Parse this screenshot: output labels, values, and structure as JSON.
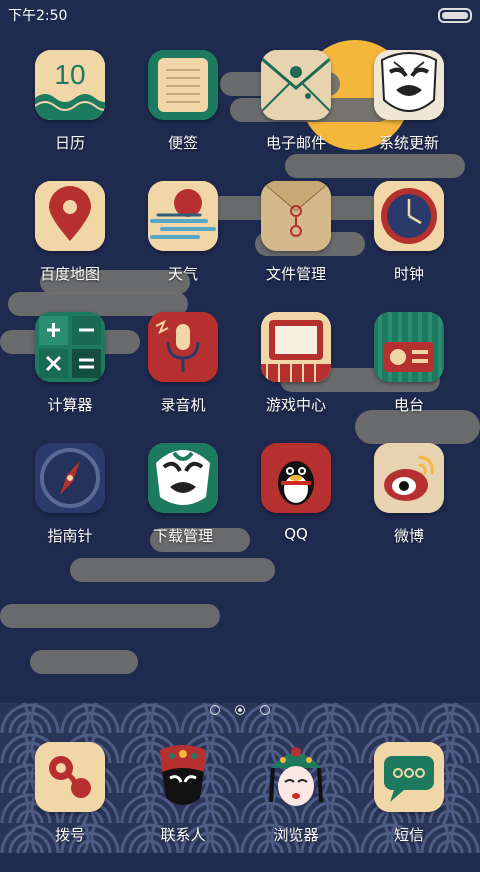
{
  "status": {
    "time": "下午2:50"
  },
  "apps": [
    {
      "label": "日历",
      "icon": "calendar-icon",
      "text": "10"
    },
    {
      "label": "便签",
      "icon": "notepad-icon"
    },
    {
      "label": "电子邮件",
      "icon": "email-icon"
    },
    {
      "label": "系统更新",
      "icon": "opera-mask-update-icon"
    },
    {
      "label": "百度地图",
      "icon": "map-pin-icon"
    },
    {
      "label": "天气",
      "icon": "weather-sun-cloud-icon"
    },
    {
      "label": "文件管理",
      "icon": "envelope-folder-icon"
    },
    {
      "label": "时钟",
      "icon": "clock-icon"
    },
    {
      "label": "计算器",
      "icon": "calculator-icon"
    },
    {
      "label": "录音机",
      "icon": "microphone-icon"
    },
    {
      "label": "游戏中心",
      "icon": "tv-game-icon"
    },
    {
      "label": "电台",
      "icon": "radio-icon"
    },
    {
      "label": "指南针",
      "icon": "compass-icon"
    },
    {
      "label": "下载管理",
      "icon": "green-mask-download-icon"
    },
    {
      "label": "QQ",
      "icon": "penguin-icon"
    },
    {
      "label": "微博",
      "icon": "weibo-eye-icon"
    }
  ],
  "dock": [
    {
      "label": "拨号",
      "icon": "phone-dial-icon"
    },
    {
      "label": "联系人",
      "icon": "opera-face-contacts-icon"
    },
    {
      "label": "浏览器",
      "icon": "opera-lady-browser-icon"
    },
    {
      "label": "短信",
      "icon": "message-bubble-icon"
    }
  ],
  "pager": {
    "pages": 3,
    "current": 2
  },
  "colors": {
    "background": "#1f2a4f",
    "tile": "#f1d7a8",
    "accent_red": "#b5302e",
    "accent_green": "#1e6b55",
    "moon": "#f4b73c"
  }
}
